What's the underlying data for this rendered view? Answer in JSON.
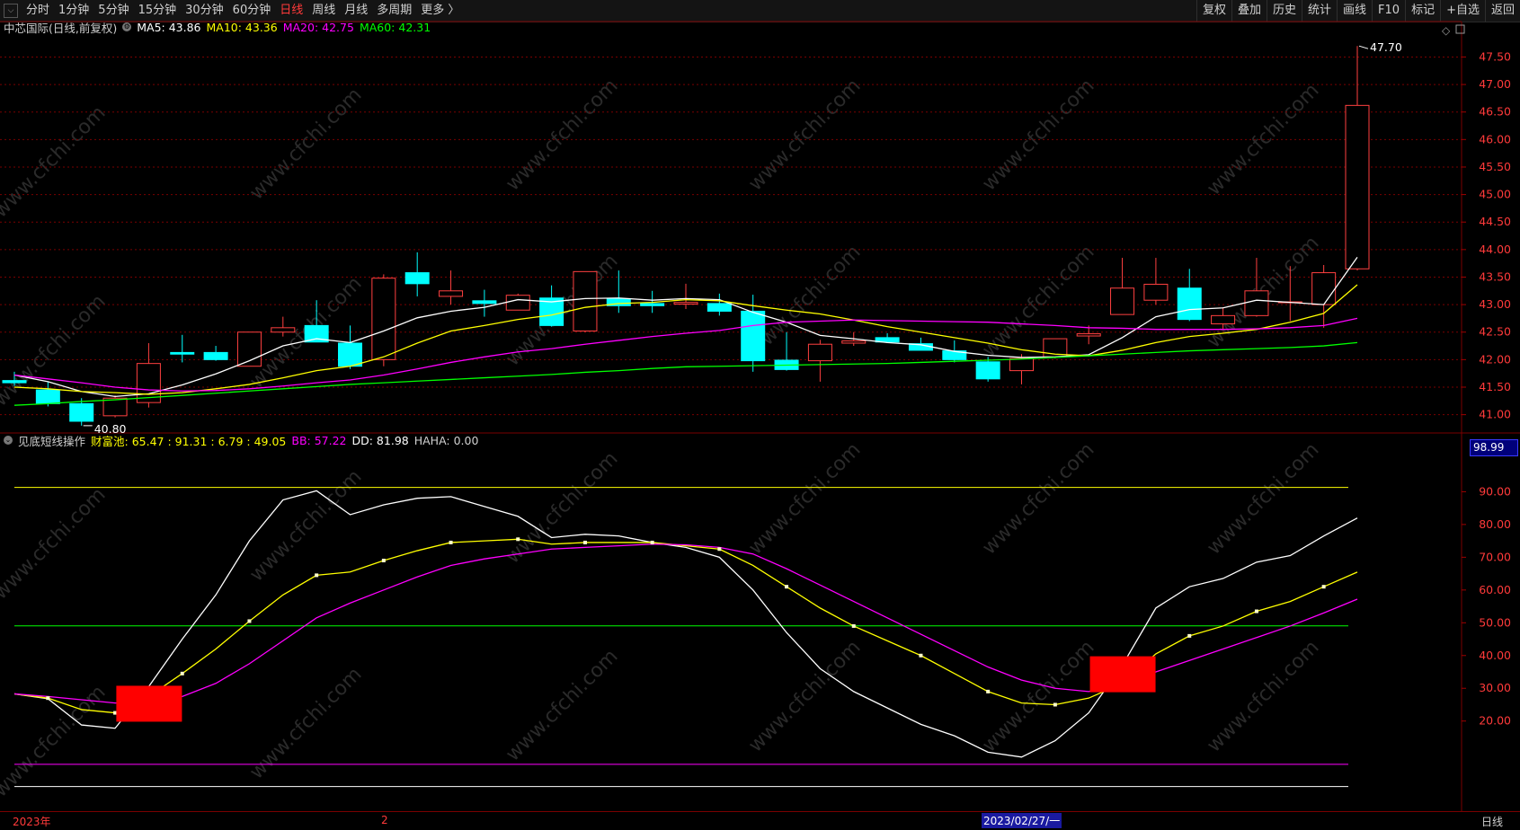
{
  "toolbar": {
    "periods": [
      "分时",
      "1分钟",
      "5分钟",
      "15分钟",
      "30分钟",
      "60分钟",
      "日线",
      "周线",
      "月线",
      "多周期",
      "更多 〉"
    ],
    "active_period": "日线",
    "right_buttons": [
      "复权",
      "叠加",
      "历史",
      "统计",
      "画线",
      "F10",
      "标记",
      "+自选",
      "返回"
    ]
  },
  "main_legend": {
    "title": "中芯国际(日线,前复权)",
    "ma5": "MA5: 43.86",
    "ma10": "MA10: 43.36",
    "ma20": "MA20: 42.75",
    "ma60": "MA60: 42.31"
  },
  "sub_legend": {
    "title": "见底短线操作",
    "caifuchi": "财富池: 65.47 : 91.31 : 6.79 : 49.05",
    "bb": "BB: 57.22",
    "dd": "DD: 81.98",
    "haha": "HAHA: 0.00"
  },
  "watermark": "www.cfchi.com",
  "bottom_bar": {
    "left_label": "2023年",
    "mid_label": "2",
    "cursor_date": "2023/02/27/一",
    "right_label": "日线"
  },
  "sub_current_value": "98.99",
  "colors": {
    "up": "#ff4040",
    "down": "#00ffff",
    "ma5": "#ffffff",
    "ma10": "#ffff00",
    "ma20": "#ff00ff",
    "ma60": "#00ff00",
    "grid": "#7a0000"
  },
  "chart_data": [
    {
      "type": "candlestick",
      "title": "中芯国际(日线,前复权)",
      "ylim": [
        40.7,
        47.85
      ],
      "y_ticks": [
        41.0,
        41.5,
        42.0,
        42.5,
        43.0,
        43.5,
        44.0,
        44.5,
        45.0,
        45.5,
        46.0,
        46.5,
        47.0,
        47.5
      ],
      "y_tick_labels": [
        "41.00",
        "41.50",
        "42.00",
        "42.50",
        "43.00",
        "43.50",
        "44.00",
        "44.50",
        "45.00",
        "45.50",
        "46.00",
        "46.50",
        "47.00",
        "47.50"
      ],
      "annotations": [
        {
          "text": "47.70",
          "value": 47.7,
          "at": "high"
        },
        {
          "text": "40.80",
          "value": 40.8,
          "at": "low"
        }
      ],
      "candles": [
        {
          "o": 41.62,
          "h": 41.78,
          "l": 41.52,
          "c": 41.58
        },
        {
          "o": 41.45,
          "h": 41.6,
          "l": 41.15,
          "c": 41.2
        },
        {
          "o": 41.2,
          "h": 41.3,
          "l": 40.8,
          "c": 40.88
        },
        {
          "o": 40.98,
          "h": 41.35,
          "l": 40.95,
          "c": 41.3
        },
        {
          "o": 41.22,
          "h": 42.3,
          "l": 41.13,
          "c": 41.93
        },
        {
          "o": 42.13,
          "h": 42.45,
          "l": 41.95,
          "c": 42.1
        },
        {
          "o": 42.13,
          "h": 42.25,
          "l": 41.98,
          "c": 42.0
        },
        {
          "o": 41.88,
          "h": 42.5,
          "l": 41.88,
          "c": 42.5
        },
        {
          "o": 42.5,
          "h": 42.78,
          "l": 42.42,
          "c": 42.58
        },
        {
          "o": 42.62,
          "h": 43.08,
          "l": 42.4,
          "c": 42.32
        },
        {
          "o": 42.3,
          "h": 42.62,
          "l": 41.83,
          "c": 41.88
        },
        {
          "o": 42.0,
          "h": 43.55,
          "l": 41.88,
          "c": 43.48
        },
        {
          "o": 43.58,
          "h": 43.95,
          "l": 43.15,
          "c": 43.38
        },
        {
          "o": 43.15,
          "h": 43.62,
          "l": 43.0,
          "c": 43.25
        },
        {
          "o": 43.07,
          "h": 43.27,
          "l": 42.78,
          "c": 43.02
        },
        {
          "o": 42.9,
          "h": 43.2,
          "l": 42.9,
          "c": 43.17
        },
        {
          "o": 43.12,
          "h": 43.35,
          "l": 42.6,
          "c": 42.62
        },
        {
          "o": 42.52,
          "h": 43.6,
          "l": 42.5,
          "c": 43.6
        },
        {
          "o": 43.1,
          "h": 43.62,
          "l": 42.85,
          "c": 42.98
        },
        {
          "o": 43.02,
          "h": 43.25,
          "l": 42.85,
          "c": 42.98
        },
        {
          "o": 43.01,
          "h": 43.38,
          "l": 42.92,
          "c": 43.04
        },
        {
          "o": 43.02,
          "h": 43.2,
          "l": 42.8,
          "c": 42.88
        },
        {
          "o": 42.88,
          "h": 43.18,
          "l": 41.78,
          "c": 41.98
        },
        {
          "o": 41.99,
          "h": 42.5,
          "l": 41.8,
          "c": 41.82
        },
        {
          "o": 41.98,
          "h": 42.36,
          "l": 41.6,
          "c": 42.28
        },
        {
          "o": 42.3,
          "h": 42.5,
          "l": 42.25,
          "c": 42.34
        },
        {
          "o": 42.4,
          "h": 42.48,
          "l": 42.3,
          "c": 42.32
        },
        {
          "o": 42.29,
          "h": 42.4,
          "l": 42.18,
          "c": 42.17
        },
        {
          "o": 42.16,
          "h": 42.35,
          "l": 41.95,
          "c": 42.0
        },
        {
          "o": 41.96,
          "h": 42.05,
          "l": 41.6,
          "c": 41.65
        },
        {
          "o": 41.8,
          "h": 42.1,
          "l": 41.55,
          "c": 42.02
        },
        {
          "o": 42.05,
          "h": 42.38,
          "l": 42.02,
          "c": 42.38
        },
        {
          "o": 42.43,
          "h": 42.62,
          "l": 42.28,
          "c": 42.47
        },
        {
          "o": 42.82,
          "h": 43.85,
          "l": 42.82,
          "c": 43.3
        },
        {
          "o": 43.08,
          "h": 43.85,
          "l": 43.0,
          "c": 43.37
        },
        {
          "o": 43.3,
          "h": 43.65,
          "l": 42.7,
          "c": 42.73
        },
        {
          "o": 42.65,
          "h": 42.95,
          "l": 42.55,
          "c": 42.8
        },
        {
          "o": 42.8,
          "h": 43.85,
          "l": 42.78,
          "c": 43.25
        },
        {
          "o": 43.05,
          "h": 43.7,
          "l": 42.7,
          "c": 43.05
        },
        {
          "o": 43.0,
          "h": 43.72,
          "l": 42.58,
          "c": 43.58
        },
        {
          "o": 43.65,
          "h": 47.7,
          "l": 43.62,
          "c": 46.62
        }
      ],
      "series": [
        {
          "name": "MA5",
          "values": [
            41.72,
            41.6,
            41.42,
            41.33,
            41.38,
            41.54,
            41.74,
            41.98,
            42.25,
            42.38,
            42.31,
            42.52,
            42.76,
            42.88,
            42.95,
            43.09,
            43.05,
            43.11,
            43.12,
            43.08,
            43.11,
            43.09,
            42.86,
            42.68,
            42.44,
            42.38,
            42.31,
            42.27,
            42.15,
            42.08,
            42.04,
            42.05,
            42.09,
            42.4,
            42.78,
            42.91,
            42.94,
            43.08,
            43.04,
            43.0,
            43.86
          ]
        },
        {
          "name": "MA10",
          "values": [
            41.5,
            41.47,
            41.42,
            41.4,
            41.37,
            41.4,
            41.47,
            41.55,
            41.67,
            41.8,
            41.88,
            42.05,
            42.3,
            42.52,
            42.62,
            42.73,
            42.81,
            42.95,
            43.02,
            43.04,
            43.09,
            43.07,
            42.98,
            42.9,
            42.83,
            42.72,
            42.6,
            42.5,
            42.4,
            42.3,
            42.18,
            42.1,
            42.07,
            42.17,
            42.31,
            42.42,
            42.48,
            42.55,
            42.68,
            42.84,
            43.36
          ]
        },
        {
          "name": "MA20",
          "values": [
            41.72,
            41.65,
            41.58,
            41.5,
            41.45,
            41.43,
            41.44,
            41.47,
            41.52,
            41.58,
            41.63,
            41.72,
            41.83,
            41.95,
            42.05,
            42.14,
            42.2,
            42.28,
            42.35,
            42.42,
            42.48,
            42.53,
            42.62,
            42.68,
            42.7,
            42.72,
            42.71,
            42.7,
            42.69,
            42.68,
            42.65,
            42.62,
            42.58,
            42.57,
            42.55,
            42.55,
            42.55,
            42.56,
            42.58,
            42.62,
            42.75
          ]
        },
        {
          "name": "MA60",
          "values": [
            41.17,
            41.2,
            41.24,
            41.27,
            41.31,
            41.35,
            41.39,
            41.43,
            41.47,
            41.51,
            41.55,
            41.58,
            41.61,
            41.64,
            41.67,
            41.7,
            41.73,
            41.77,
            41.8,
            41.84,
            41.87,
            41.88,
            41.89,
            41.9,
            41.91,
            41.92,
            41.93,
            41.95,
            41.97,
            41.99,
            42.01,
            42.04,
            42.07,
            42.1,
            42.13,
            42.16,
            42.18,
            42.2,
            42.22,
            42.25,
            42.31
          ]
        }
      ]
    },
    {
      "type": "line",
      "title": "见底短线操作",
      "ylim": [
        -7.5,
        103
      ],
      "y_ticks": [
        20,
        30,
        40,
        50,
        60,
        70,
        80,
        90
      ],
      "y_tick_labels": [
        "20.00",
        "30.00",
        "40.00",
        "50.00",
        "60.00",
        "70.00",
        "80.00",
        "90.00"
      ],
      "hlines": [
        {
          "value": 91.31,
          "color": "#ffff00"
        },
        {
          "value": 49.05,
          "color": "#00ff00"
        },
        {
          "value": 6.79,
          "color": "#ff00ff"
        },
        {
          "value": 0,
          "color": "#ffffff"
        }
      ],
      "series": [
        {
          "name": "DD",
          "color": "#ffffff",
          "values": [
            28.3,
            26.8,
            18.8,
            17.8,
            30.5,
            45.0,
            58.5,
            75.0,
            87.5,
            90.3,
            83.0,
            86.0,
            88.0,
            88.5,
            85.5,
            82.5,
            76.0,
            77.0,
            76.5,
            74.5,
            73.0,
            70.0,
            60.0,
            47.0,
            36.0,
            29.0,
            24.0,
            19.0,
            15.5,
            10.5,
            9.0,
            14.0,
            22.5,
            37.0,
            54.5,
            61.0,
            63.5,
            68.5,
            70.5,
            76.5,
            81.98
          ]
        },
        {
          "name": "财富池",
          "color": "#ffff00",
          "values": [
            28.3,
            27.0,
            23.5,
            22.5,
            27.5,
            34.5,
            42.0,
            50.5,
            58.5,
            64.5,
            65.5,
            69.0,
            72.0,
            74.5,
            75.0,
            75.5,
            74.0,
            74.5,
            74.5,
            74.5,
            73.5,
            72.5,
            67.5,
            61.0,
            54.5,
            49.0,
            44.5,
            40.0,
            34.5,
            29.0,
            25.5,
            25.0,
            27.0,
            31.5,
            40.5,
            46.0,
            49.0,
            53.5,
            56.5,
            61.0,
            65.47
          ]
        },
        {
          "name": "BB",
          "color": "#ff00ff",
          "values": [
            28.3,
            27.5,
            26.5,
            25.5,
            25.5,
            27.5,
            31.5,
            37.5,
            44.5,
            51.5,
            56.0,
            60.0,
            64.0,
            67.5,
            69.5,
            71.0,
            72.5,
            73.0,
            73.5,
            74.0,
            73.8,
            73.0,
            71.0,
            66.5,
            61.5,
            56.5,
            51.5,
            46.5,
            41.5,
            36.5,
            32.5,
            30.0,
            29.0,
            31.5,
            35.0,
            38.5,
            42.0,
            45.5,
            49.0,
            53.0,
            57.22
          ]
        }
      ],
      "markers": [
        {
          "value": 19.8,
          "color": "#ff0000",
          "shape": "box",
          "at_index": 4
        },
        {
          "value": 28.8,
          "color": "#ff0000",
          "shape": "box",
          "at_index": 33
        }
      ]
    }
  ]
}
